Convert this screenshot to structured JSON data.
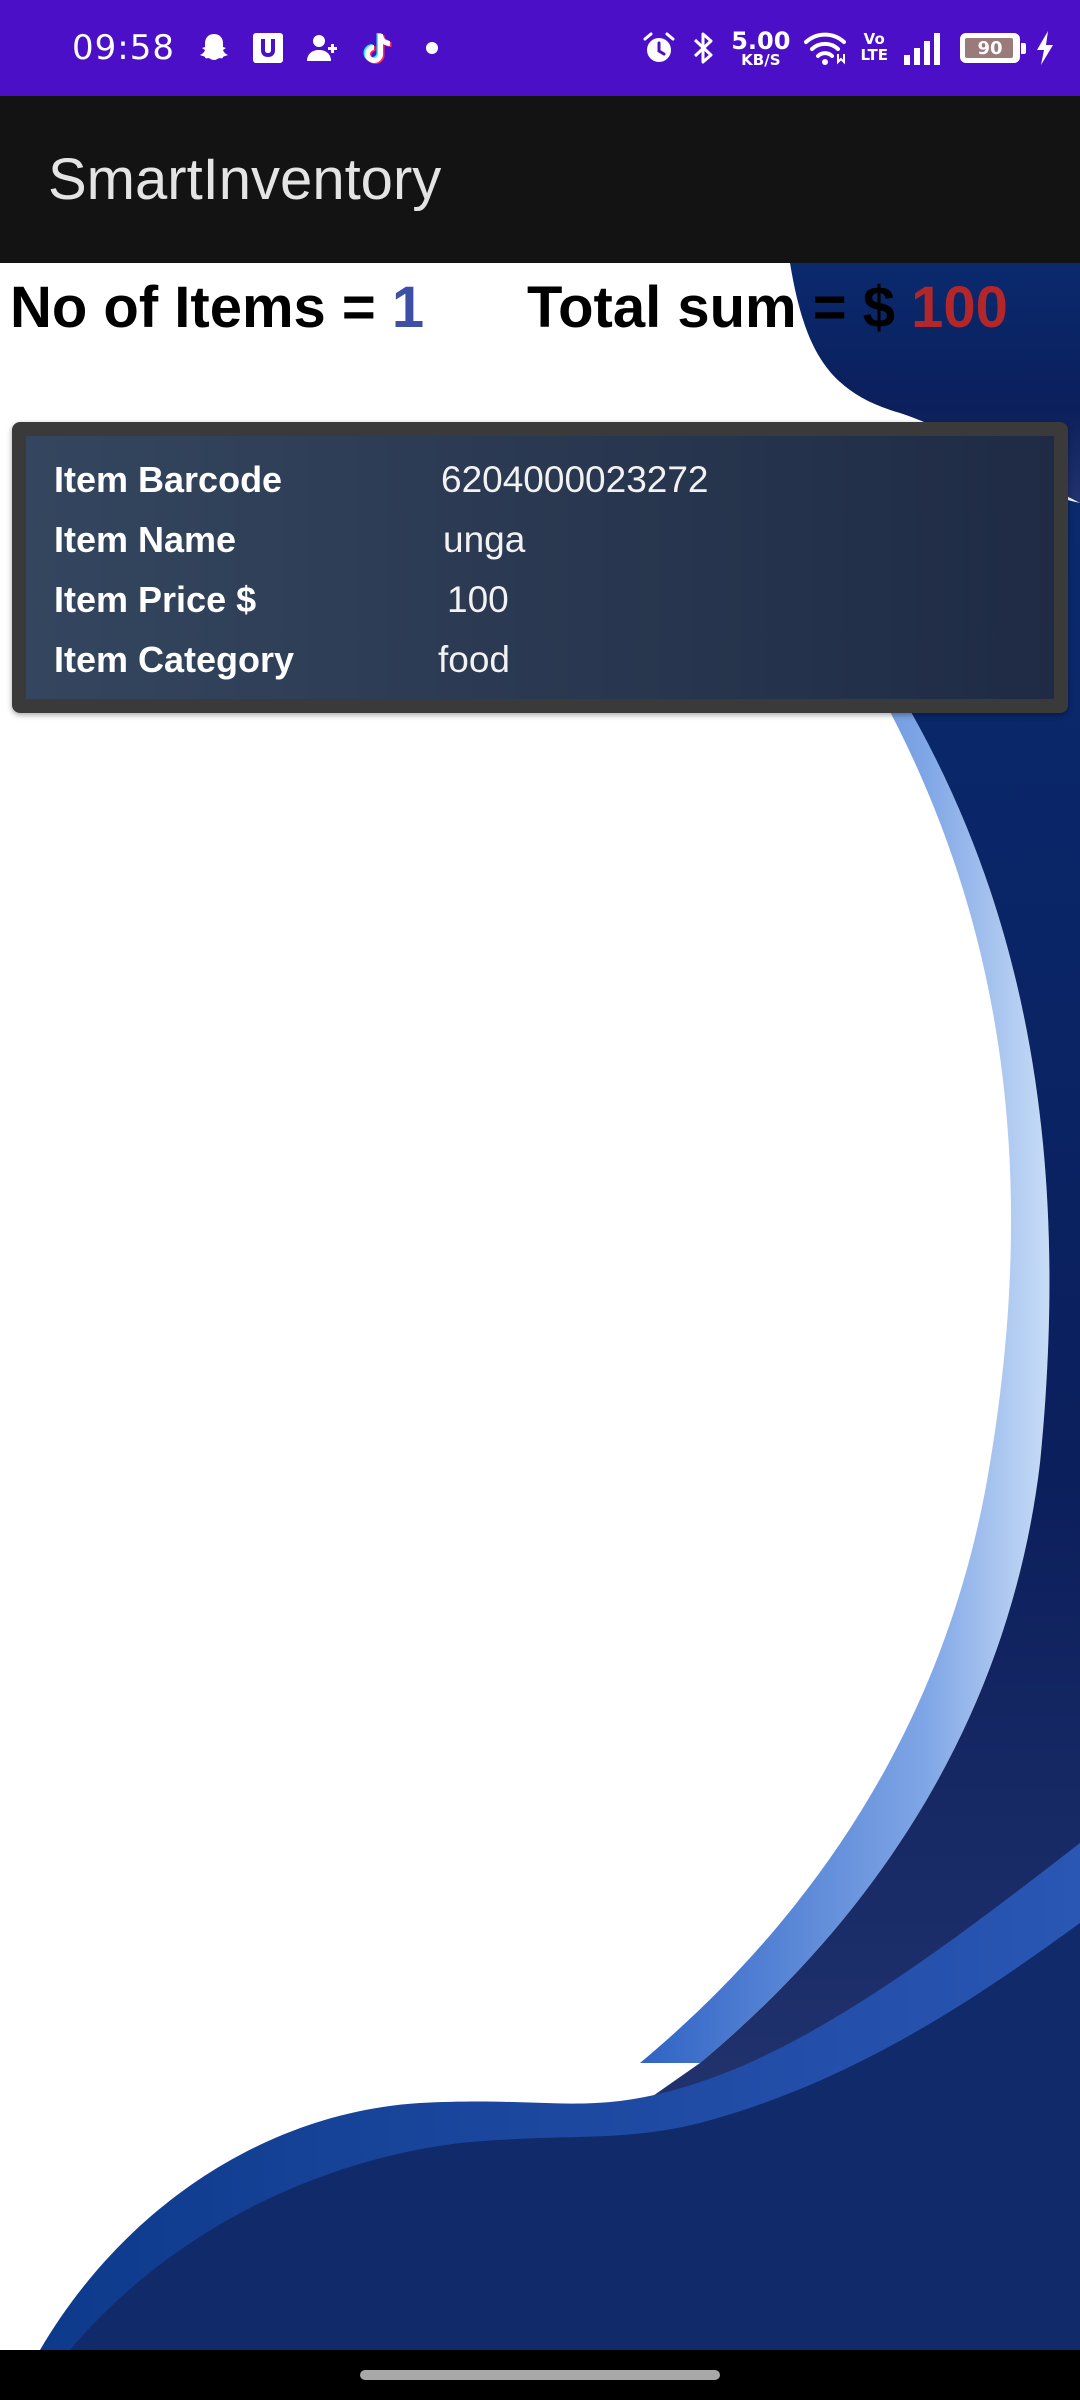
{
  "status_bar": {
    "time": "09:58",
    "net_speed_value": "5.00",
    "net_speed_unit": "KB/S",
    "volte_top": "Vo",
    "volte_bottom": "LTE",
    "battery_level": "90",
    "notification_icons": [
      "snapchat-icon",
      "u-app-icon",
      "add-contact-icon",
      "tiktok-icon",
      "more-notifications-dot"
    ],
    "system_icons": [
      "alarm-icon",
      "bluetooth-icon",
      "wifi-icon",
      "signal-icon",
      "battery-icon",
      "charging-icon"
    ],
    "color": "#4a0fc7"
  },
  "app_bar": {
    "title": "SmartInventory",
    "color": "#131313"
  },
  "summary": {
    "items_label": "No of Items = ",
    "items_count": "1",
    "sum_label": "Total sum = $ ",
    "sum_value": "100",
    "count_color": "#3e4fa6",
    "sum_color": "#b3262a"
  },
  "items": [
    {
      "barcode_label": "Item Barcode",
      "barcode": "6204000023272",
      "name_label": "Item Name",
      "name": "unga",
      "price_label": "Item Price $",
      "price": "100",
      "category_label": "Item Category",
      "category": "food"
    }
  ],
  "colors": {
    "wave_dark": "#0b2466",
    "wave_mid": "#2a5cbe",
    "wave_light": "#9cc0ee"
  }
}
